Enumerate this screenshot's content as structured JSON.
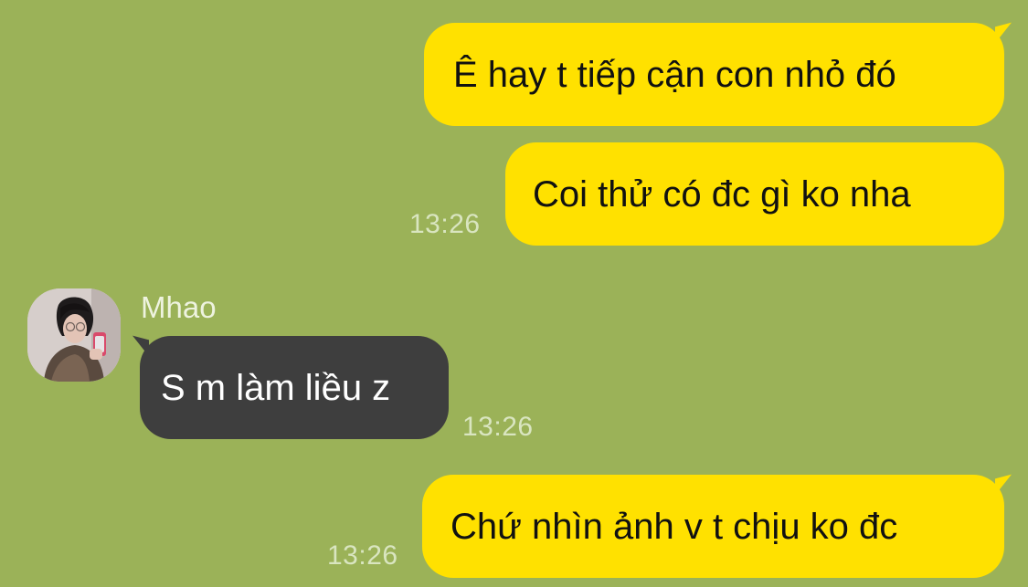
{
  "chat": {
    "messages": [
      {
        "direction": "outgoing",
        "text": "Ê hay t tiếp cận con nhỏ đó",
        "time": ""
      },
      {
        "direction": "outgoing",
        "text": "Coi thử có đc gì ko nha",
        "time": "13:26"
      },
      {
        "direction": "incoming",
        "sender": "Mhao",
        "text": "S m làm liều z",
        "time": "13:26"
      },
      {
        "direction": "outgoing",
        "text": "Chứ nhìn ảnh v t chịu ko đc",
        "time": "13:26"
      }
    ]
  },
  "colors": {
    "background": "#9bb258",
    "outgoing_bubble": "#ffe100",
    "incoming_bubble": "#3e3e3e",
    "timestamp": "#d9e5c0"
  },
  "icons": {
    "avatar": "profile-photo"
  }
}
